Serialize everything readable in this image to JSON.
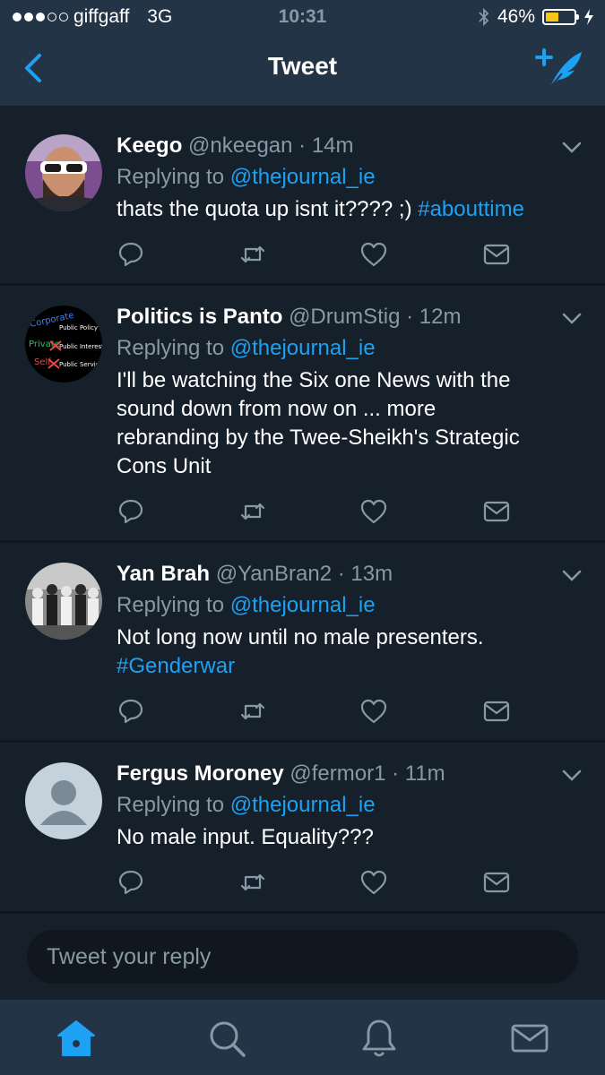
{
  "status_bar": {
    "carrier": "giffgaff",
    "network": "3G",
    "time": "10:31",
    "battery": "46%",
    "battery_level": 0.46,
    "colors": {
      "battery_fill": "#f5c518"
    }
  },
  "nav": {
    "title": "Tweet",
    "back_icon": "chevron-left-icon",
    "compose_icon": "compose-tweet-icon"
  },
  "tweets": [
    {
      "name": "Keego",
      "handle": "@nkeegan",
      "time": "· 14m",
      "reply_prefix": "Replying to",
      "reply_to": "@thejournal_ie",
      "lines": [
        {
          "text": "thats the quota up isnt it???? ;) ",
          "hashtag": "#abouttime"
        }
      ]
    },
    {
      "name": "Politics is Panto",
      "handle": "@DrumStig",
      "time": "· 12m",
      "reply_prefix": "Replying to",
      "reply_to": "@thejournal_ie",
      "lines": [
        {
          "text": "I'll be watching the Six one News with the",
          "hashtag": ""
        },
        {
          "text": "sound down from now on ... more",
          "hashtag": ""
        },
        {
          "text": "rebranding by the Twee-Sheikh's Strategic",
          "hashtag": ""
        },
        {
          "text": "Cons Unit",
          "hashtag": ""
        }
      ],
      "avatar_words": [
        "Corporate",
        "Public Policy",
        "Private",
        "Public Interest",
        "Self",
        "Public Service"
      ]
    },
    {
      "name": "Yan Brah",
      "handle": "@YanBran2",
      "time": "· 13m",
      "reply_prefix": "Replying to",
      "reply_to": "@thejournal_ie",
      "lines": [
        {
          "text": "Not long now until no male presenters.",
          "hashtag": ""
        },
        {
          "text": "",
          "hashtag": "#Genderwar"
        }
      ]
    },
    {
      "name": "Fergus Moroney",
      "handle": "@fermor1",
      "time": "· 11m",
      "reply_prefix": "Replying to",
      "reply_to": "@thejournal_ie",
      "lines": [
        {
          "text": "No male input. Equality???",
          "hashtag": ""
        }
      ]
    }
  ],
  "action_icons": [
    "reply-icon",
    "retweet-icon",
    "like-icon",
    "direct-message-icon"
  ],
  "reply_bar": {
    "placeholder": "Tweet your reply"
  },
  "tab_bar": {
    "items": [
      "home-icon",
      "search-icon",
      "notifications-icon",
      "messages-icon"
    ],
    "active": "home-icon",
    "colors": {
      "active": "#1da1f2",
      "inactive": "#8899a6"
    }
  },
  "colors": {
    "background": "#15202b",
    "header": "#243447",
    "accent": "#1da1f2",
    "muted": "#8899a6"
  }
}
